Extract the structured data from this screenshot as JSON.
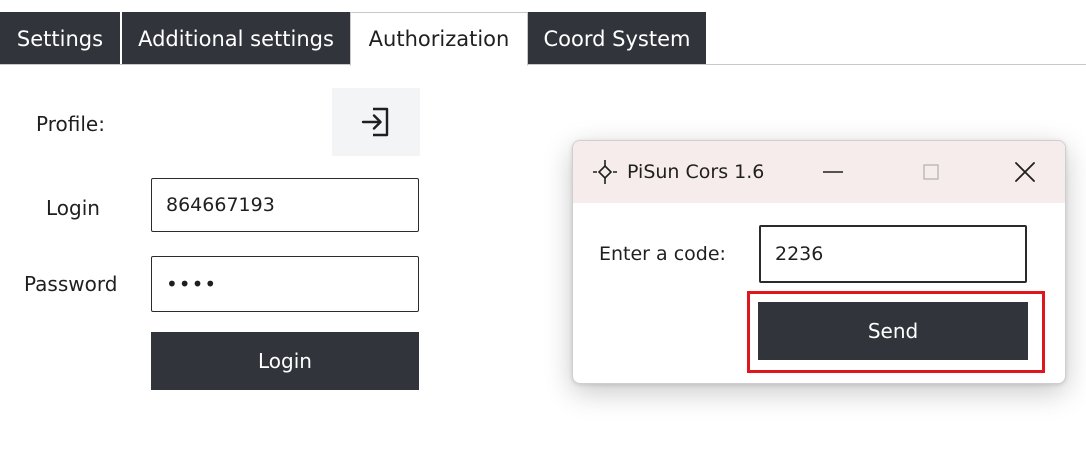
{
  "tabs": [
    {
      "label": "Settings"
    },
    {
      "label": "Additional settings"
    },
    {
      "label": "Authorization"
    },
    {
      "label": "Coord System"
    }
  ],
  "form": {
    "profile_label": "Profile:",
    "login_label": "Login",
    "login_value": "864667193",
    "password_label": "Password",
    "password_value": "••••",
    "login_button": "Login"
  },
  "dialog": {
    "title": "PiSun Cors 1.6",
    "code_label": "Enter a code:",
    "code_value": "2236",
    "send_button": "Send"
  },
  "icons": {
    "profile_action": "login-icon",
    "app": "app-crosshair-icon"
  },
  "colors": {
    "tab_dark": "#31353b",
    "button_dark": "#31353b",
    "highlight": "#e0161d",
    "titlebar": "#f7ecec"
  }
}
